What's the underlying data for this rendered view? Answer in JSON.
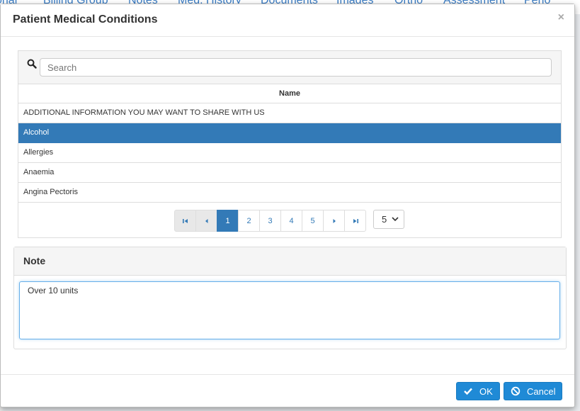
{
  "background_tabs": [
    "onal",
    "Billing Group",
    "Notes",
    "Med. History",
    "Documents",
    "Images",
    "Ortho",
    "Assessment",
    "Perio"
  ],
  "modal": {
    "title": "Patient Medical Conditions",
    "close_label": "×"
  },
  "search": {
    "placeholder": "Search",
    "value": ""
  },
  "table": {
    "column_header": "Name",
    "rows": [
      {
        "label": "ADDITIONAL INFORMATION YOU MAY WANT TO SHARE WITH US",
        "selected": false
      },
      {
        "label": "Alcohol",
        "selected": true
      },
      {
        "label": "Allergies",
        "selected": false
      },
      {
        "label": "Anaemia",
        "selected": false
      },
      {
        "label": "Angina Pectoris",
        "selected": false
      }
    ]
  },
  "pagination": {
    "pages": [
      "1",
      "2",
      "3",
      "4",
      "5"
    ],
    "current_page": "1",
    "page_size": "5"
  },
  "note": {
    "heading": "Note",
    "value": "Over 10 units"
  },
  "footer": {
    "ok_label": "OK",
    "cancel_label": "Cancel"
  },
  "colors": {
    "accent": "#337ab7",
    "button": "#1f8ad6"
  }
}
